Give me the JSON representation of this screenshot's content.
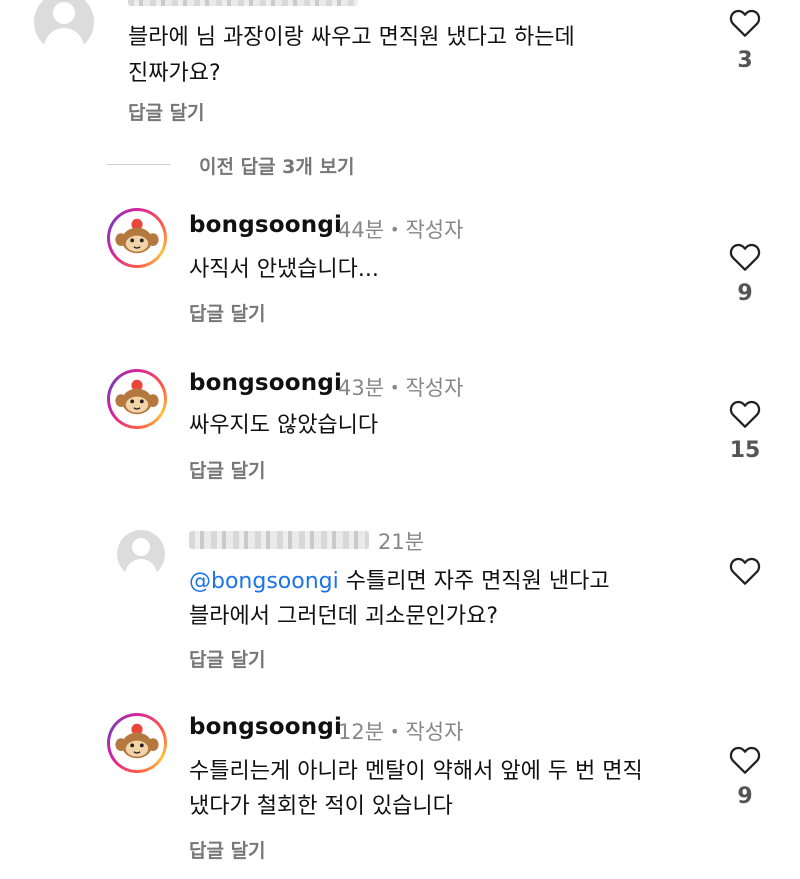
{
  "comments": [
    {
      "text": "블라에 님 과장이랑 싸우고 면직원 냈다고 하는데",
      "text2": "진짜가요?",
      "reply": "답글 달기",
      "likes": "3"
    },
    {
      "username": "bongsoongi",
      "time": "44분",
      "author_tag": "작성자",
      "text": "사직서 안냈습니다...",
      "reply": "답글 달기",
      "likes": "9"
    },
    {
      "username": "bongsoongi",
      "time": "43분",
      "author_tag": "작성자",
      "text": "싸우지도 않았습니다",
      "reply": "답글 달기",
      "likes": "15"
    },
    {
      "time": "21분",
      "mention": "@bongsoongi",
      "text": " 수틀리면 자주 면직원 낸다고",
      "text2": "블라에서 그러던데 괴소문인가요?",
      "reply": "답글 달기"
    },
    {
      "username": "bongsoongi",
      "time": "12분",
      "author_tag": "작성자",
      "text": "수틀리는게 아니라 멘탈이 약해서 앞에 두 번 면직",
      "text2": "냈다가 철회한 적이 있습니다",
      "reply": "답글 달기",
      "likes": "9"
    }
  ],
  "view_previous": "이전 답글 3개 보기",
  "icons": {
    "like": "heart-outline-icon",
    "avatar_default": "default-avatar-icon",
    "avatar_user": "monkey-avatar-icon"
  }
}
